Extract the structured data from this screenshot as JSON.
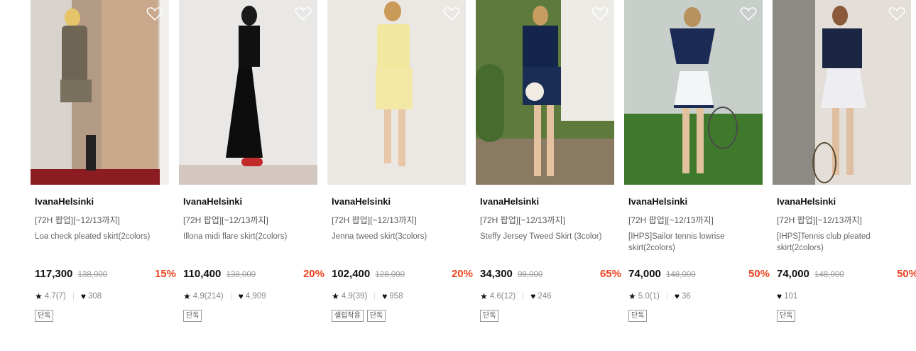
{
  "products": [
    {
      "brand": "IvanaHelsinki",
      "promo": "[72H 팝업][~12/13까지]",
      "name": "Loa check pleated skirt(2colors)",
      "price": "117,300",
      "original_price": "138,000",
      "discount": "15%",
      "rating": "4.7(7)",
      "likes": "308",
      "tags": [
        "단독"
      ],
      "wish_icon": "heart-outline-icon"
    },
    {
      "brand": "IvanaHelsinki",
      "promo": "[72H 팝업][~12/13까지]",
      "name": "Illona midi flare skirt(2colors)",
      "price": "110,400",
      "original_price": "138,000",
      "discount": "20%",
      "rating": "4.9(214)",
      "likes": "4,909",
      "tags": [
        "단독"
      ],
      "wish_icon": "heart-outline-icon"
    },
    {
      "brand": "IvanaHelsinki",
      "promo": "[72H 팝업][~12/13까지]",
      "name": "Jenna tweed skirt(3colors)",
      "price": "102,400",
      "original_price": "128,000",
      "discount": "20%",
      "rating": "4.9(39)",
      "likes": "958",
      "tags": [
        "셀럽착용",
        "단독"
      ],
      "wish_icon": "heart-outline-icon"
    },
    {
      "brand": "IvanaHelsinki",
      "promo": "[72H 팝업][~12/13까지]",
      "name": "Steffy Jersey Tweed Skirt (3color)",
      "price": "34,300",
      "original_price": "98,000",
      "discount": "65%",
      "rating": "4.6(12)",
      "likes": "246",
      "tags": [
        "단독"
      ],
      "wish_icon": "heart-outline-icon"
    },
    {
      "brand": "IvanaHelsinki",
      "promo": "[72H 팝업][~12/13까지]",
      "name": "[IHPS]Sailor tennis lowrise skirt(2colors)",
      "price": "74,000",
      "original_price": "148,000",
      "discount": "50%",
      "rating": "5.0(1)",
      "likes": "36",
      "tags": [
        "단독"
      ],
      "wish_icon": "heart-outline-icon"
    },
    {
      "brand": "IvanaHelsinki",
      "promo": "[72H 팝업][~12/13까지]",
      "name": "[IHPS]Tennis club pleated skirt(2colors)",
      "price": "74,000",
      "original_price": "148,000",
      "discount": "50%",
      "rating": null,
      "likes": "101",
      "tags": [
        "단독"
      ],
      "wish_icon": "heart-outline-icon"
    }
  ],
  "colors": {
    "discount": "#f0441f",
    "text": "#111111",
    "muted": "#888888"
  }
}
